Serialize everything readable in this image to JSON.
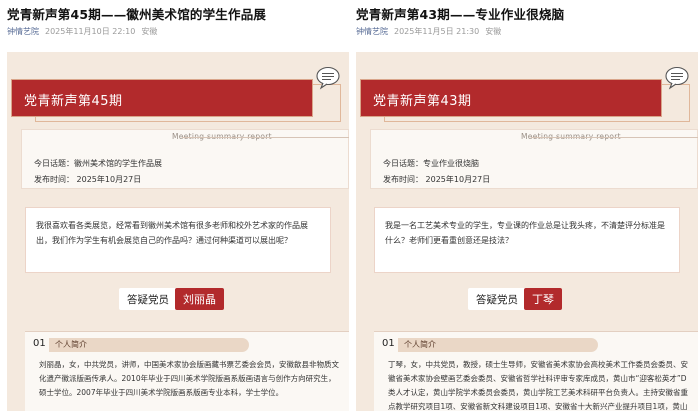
{
  "left": {
    "title": "党青新声第45期——徽州美术馆的学生作品展",
    "account": "钟情艺院",
    "datetime": "2025年11月10日 22:10",
    "location": "安徽",
    "banner": "党青新声第45期",
    "summary_label": "Meeting summary report",
    "topic": "今日话题：徽州美术馆的学生作品展",
    "pub_time": "发布时间：  2025年10月27日",
    "question": "我很喜欢看各类展览，经常看到徽州美术馆有很多老师和校外艺术家的作品展出，我们作为学生有机会展览自己的作品吗？通过何种渠道可以展出呢？",
    "answer_label": "答疑党员",
    "answer_name": "刘丽晶",
    "profile_num": "01",
    "profile_tag": "个人简介",
    "profile_text": "刘丽晶，女，中共党员，讲师，中国美术家协会版画藏书票艺委会会员，安徽歙县非物质文化遗产徽派版画传承人。2010年毕业于四川美术学院版画系版画语言与创作方向研究生，硕士学位。2007年毕业于四川美术学院版画系版画专业本科，学士学位。"
  },
  "right": {
    "title": "党青新声第43期——专业作业很烧脑",
    "account": "钟情艺院",
    "datetime": "2025年11月5日 21:30",
    "location": "安徽",
    "banner": "党青新声第43期",
    "summary_label": "Meeting summary report",
    "topic": "今日话题：专业作业很烧脑",
    "pub_time": "发布时间：  2025年10月27日",
    "question": "我是一名工艺美术专业的学生，专业课的作业总是让我头疼，不清楚评分标准是什么？老师们更看重创意还是技法？",
    "answer_label": "答疑党员",
    "answer_name": "丁琴",
    "profile_num": "01",
    "profile_tag": "个人简介",
    "profile_text": "丁琴，女，中共党员，教授，硕士生导师，安徽省美术家协会高校美术工作委员会委员、安徽省美术家协会壁画艺委会委员、安徽省哲学社科评审专家库成员，黄山市“迎客松英才”D类人才认定，黄山学院学术委员会委员，黄山学院工艺美术科研平台负责人。主持安徽省重点教学研究项目1项、安徽省新文科建设项目1项、安徽省十大新兴产业提升项目1项，黄山市"
  }
}
